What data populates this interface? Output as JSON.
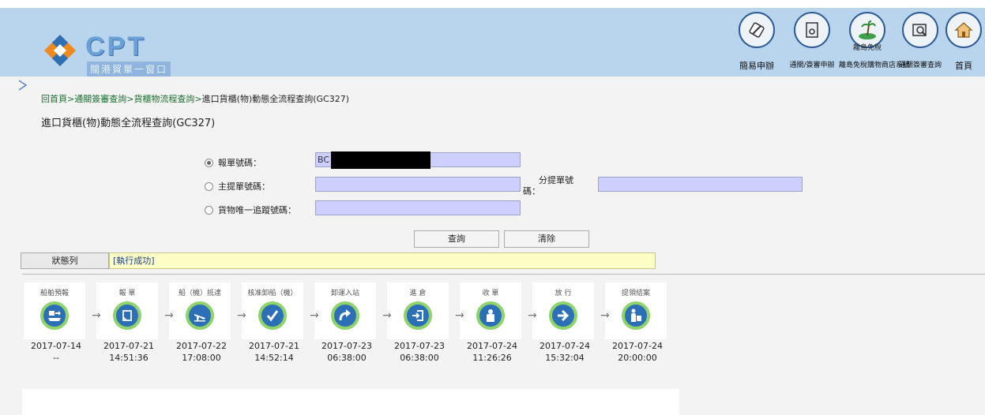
{
  "header": {
    "logo_text": "CPT",
    "logo_sub": "關港貿單一窗口",
    "nav": [
      {
        "label": "簡易申辦",
        "icon": "pen-icon"
      },
      {
        "label": "通關/簽審申辦",
        "icon": "document-icon"
      },
      {
        "label": "離島免稅購物商店系統",
        "icon": "island-icon"
      },
      {
        "label": "通關簽審查詢",
        "icon": "magnifier-icon"
      },
      {
        "label": "首頁",
        "icon": "home-icon"
      }
    ],
    "island_badge": "離島免稅"
  },
  "breadcrumb": {
    "items": [
      "回首頁",
      "通關簽審查詢",
      "貨櫃物流程查詢"
    ],
    "separator": ">",
    "current": "進口貨櫃(物)動態全流程查詢(GC327)"
  },
  "page_title": "進口貨櫃(物)動態全流程查詢(GC327)",
  "form": {
    "option1_label": "報單號碼：",
    "option1_value": "BC",
    "option2_label": "主提單號碼：",
    "option2_value": "",
    "sub_bl_label_line1": "分提單號",
    "sub_bl_label_line2": "碼：",
    "sub_bl_value": "",
    "option3_label": "貨物唯一追蹤號碼：",
    "option3_value": "",
    "query_button": "查詢",
    "clear_button": "清除"
  },
  "status": {
    "label": "狀態列",
    "message": "[執行成功]"
  },
  "steps": [
    {
      "name": "船舶預報",
      "date": "2017-07-14",
      "time": "--",
      "icon": "ship-forecast-icon"
    },
    {
      "name": "報 單",
      "date": "2017-07-21",
      "time": "14:51:36",
      "icon": "declaration-icon"
    },
    {
      "name": "船（機）抵達",
      "date": "2017-07-22",
      "time": "17:08:00",
      "icon": "plane-arrival-icon"
    },
    {
      "name": "核准卸船（機）",
      "date": "2017-07-21",
      "time": "14:52:14",
      "icon": "check-icon"
    },
    {
      "name": "卸運入站",
      "date": "2017-07-23",
      "time": "06:38:00",
      "icon": "curved-arrow-icon"
    },
    {
      "name": "進 倉",
      "date": "2017-07-23",
      "time": "06:38:00",
      "icon": "enter-warehouse-icon"
    },
    {
      "name": "收 單",
      "date": "2017-07-24",
      "time": "11:26:26",
      "icon": "receive-person-icon"
    },
    {
      "name": "放 行",
      "date": "2017-07-24",
      "time": "15:32:04",
      "icon": "release-arrow-icon"
    },
    {
      "name": "提領結案",
      "date": "2017-07-24",
      "time": "20:00:00",
      "icon": "pickup-icon"
    }
  ],
  "colors": {
    "header_bg": "#b9d5ee",
    "input_bg": "#cdd0ff",
    "status_bg": "#fdfdc6",
    "step_icon": "#2c6fb6",
    "step_ring": "#8fd36c"
  }
}
